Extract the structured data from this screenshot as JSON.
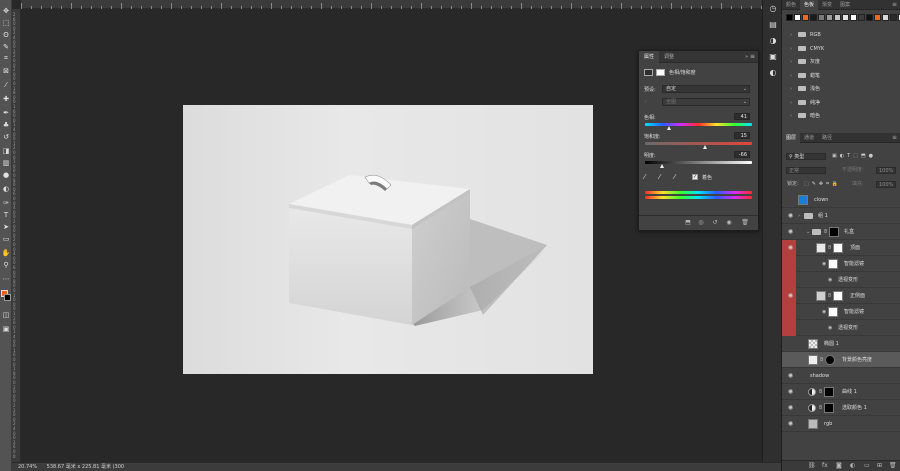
{
  "status": {
    "zoom": "20.74%",
    "doc_info": "538.67 毫米 x 225.81 毫米 (300"
  },
  "ruler_labels": [
    "2",
    "6",
    "0",
    "0",
    "2",
    "4",
    "0",
    "0",
    "2",
    "2",
    "0",
    "0",
    "2",
    "0",
    "0",
    "0",
    "1",
    "8",
    "0",
    "0",
    "1",
    "6",
    "0",
    "0",
    "1",
    "4",
    "0",
    "0",
    "1",
    "2",
    "0",
    "0",
    "1",
    "0",
    "0",
    "0",
    "8",
    "0",
    "0",
    "6",
    "0",
    "0",
    "4",
    "0",
    "0",
    "2",
    "0",
    "0",
    "0",
    "2",
    "0",
    "0",
    "4",
    "0",
    "0",
    "6",
    "0",
    "0",
    "8",
    "0",
    "0",
    "1",
    "0",
    "0",
    "0",
    "1",
    "2",
    "0",
    "0",
    "1",
    "4",
    "0",
    "0",
    "1",
    "6",
    "0",
    "0",
    "1",
    "8",
    "0",
    "0",
    "2",
    "0",
    "0",
    "0",
    "2",
    "2",
    "0",
    "0",
    "2",
    "4",
    "0",
    "0",
    "2",
    "6",
    "0",
    "0"
  ],
  "properties": {
    "tabs": [
      "属性",
      "调整"
    ],
    "collapse": "»",
    "menu": "≡",
    "header": "色相/饱和度",
    "preset_label": "预设:",
    "preset_value": "自定",
    "channel_value": "全图",
    "hue_label": "色相:",
    "hue_value": "41",
    "sat_label": "饱和度:",
    "sat_value": "15",
    "light_label": "明度:",
    "light_value": "-66",
    "colorize_label": "着色",
    "hue": 41,
    "saturation": 15,
    "lightness": -66
  },
  "swatches_panel": {
    "tabs": [
      "颜色",
      "色板",
      "渐变",
      "图案"
    ],
    "colors": [
      "#000000",
      "#ffffff",
      "#f26a1b",
      "#1b1b1b",
      "#7a7a7a",
      "#9a9a9a",
      "#c4c4c4",
      "#e4e4e4",
      "#ffffff",
      "#3d3d3d",
      "#111111",
      "#f06a1c",
      "#d8d8d8",
      "#2a2a2a",
      "#ffffff",
      "#a8a8a8"
    ],
    "groups": [
      "RGB",
      "CMYK",
      "灰度",
      "蜡笔",
      "浅色",
      "纯净",
      "暗色"
    ]
  },
  "layers_panel": {
    "tabs": [
      "图层",
      "通道",
      "路径"
    ],
    "kind_label": "类型",
    "blend_mode": "正常",
    "opacity_label": "不透明度:",
    "opacity_value": "100%",
    "lock_label": "锁定:",
    "fill_label": "填充:",
    "fill_value": "100%",
    "layers": [
      {
        "name": "clown"
      },
      {
        "name": "组 1"
      },
      {
        "name": "礼盒"
      },
      {
        "name": "顶面"
      },
      {
        "name": "智能滤镜"
      },
      {
        "name": "透视变形"
      },
      {
        "name": "正侧面"
      },
      {
        "name": "智能滤镜"
      },
      {
        "name": "透视变形"
      },
      {
        "name": "椭圆 1"
      },
      {
        "name": "背景颜色亮度"
      },
      {
        "name": "shadow"
      },
      {
        "name": "曲线 1"
      },
      {
        "name": "选取颜色 1"
      },
      {
        "name": "rgb"
      }
    ],
    "footer_icons": [
      "link",
      "fx",
      "mask",
      "adjustment",
      "group",
      "new",
      "trash"
    ]
  },
  "colors": {
    "foreground": "#e8621d",
    "background": "#000000",
    "accent_red": "#b3403f"
  }
}
